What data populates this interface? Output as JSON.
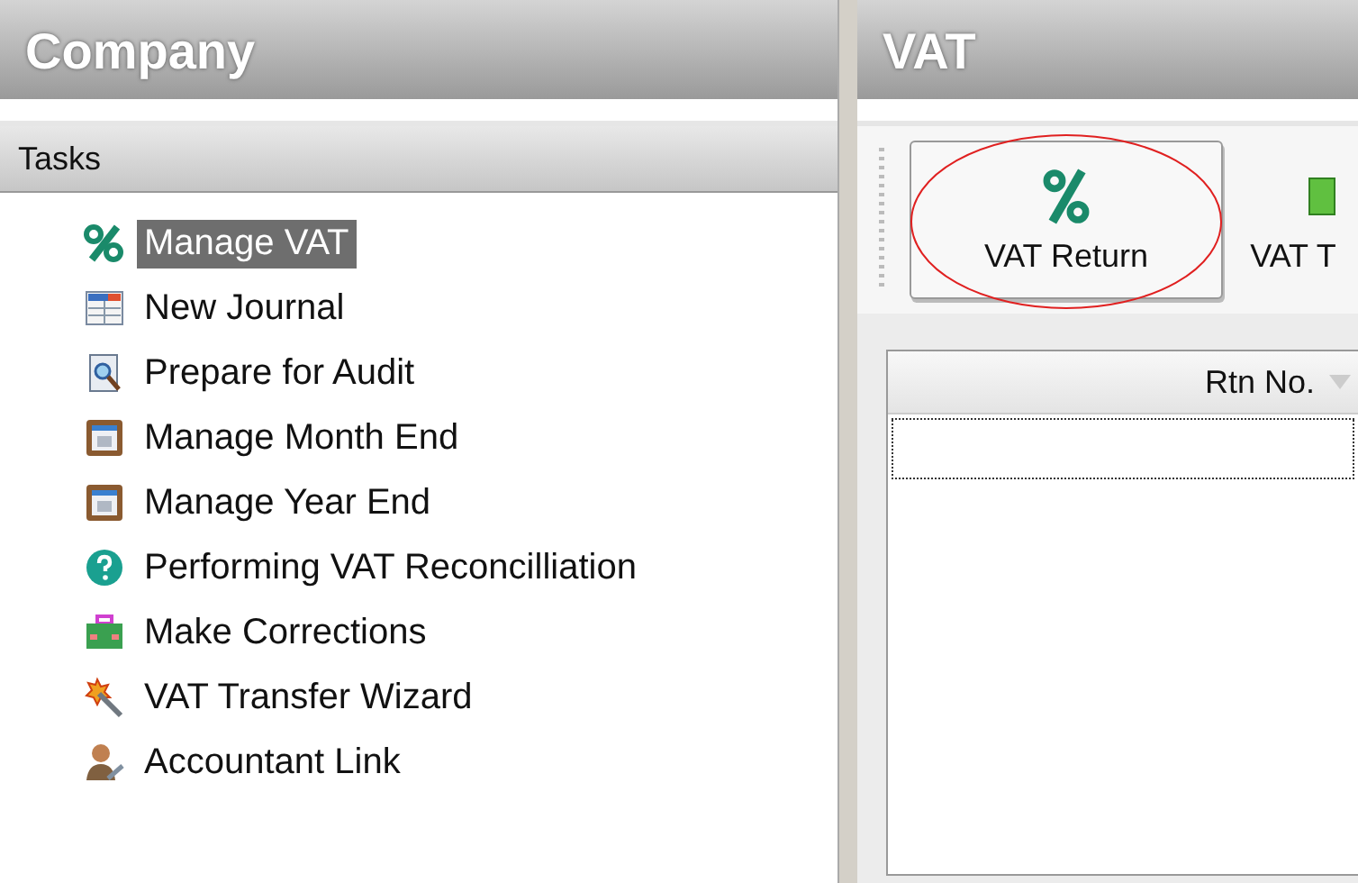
{
  "left_panel": {
    "title": "Company",
    "section": "Tasks",
    "tasks": [
      {
        "label": "Manage VAT",
        "kind": "percent",
        "selected": true
      },
      {
        "label": "New Journal",
        "kind": "journal",
        "selected": false
      },
      {
        "label": "Prepare for Audit",
        "kind": "audit",
        "selected": false
      },
      {
        "label": "Manage Month End",
        "kind": "calendar",
        "selected": false
      },
      {
        "label": "Manage Year End",
        "kind": "calendar",
        "selected": false
      },
      {
        "label": "Performing VAT Reconcilliation",
        "kind": "help",
        "selected": false
      },
      {
        "label": "Make Corrections",
        "kind": "toolbox",
        "selected": false
      },
      {
        "label": "VAT Transfer Wizard",
        "kind": "wizard",
        "selected": false
      },
      {
        "label": "Accountant Link",
        "kind": "person",
        "selected": false
      }
    ]
  },
  "right_panel": {
    "title": "VAT",
    "toolbar": [
      {
        "label": "VAT Return",
        "kind": "percent",
        "circled": true
      },
      {
        "label": "VAT T",
        "kind": "document",
        "circled": false
      }
    ],
    "table": {
      "columns": [
        "Rtn No."
      ]
    }
  }
}
